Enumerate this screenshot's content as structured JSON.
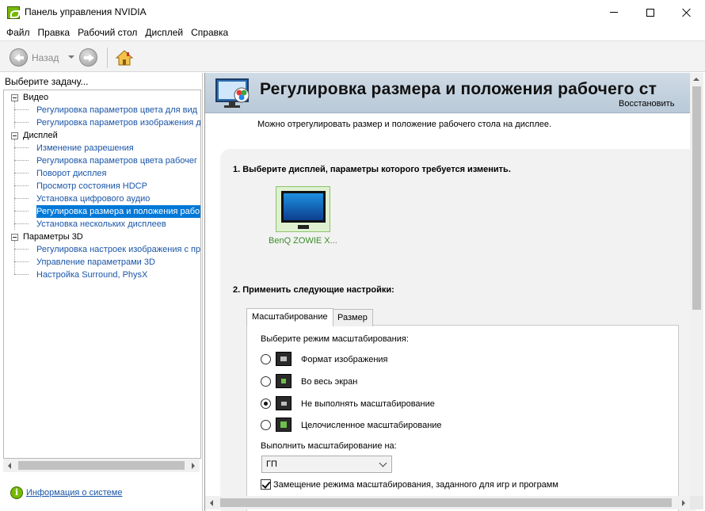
{
  "window": {
    "title": "Панель управления NVIDIA"
  },
  "menu": [
    "Файл",
    "Правка",
    "Рабочий стол",
    "Дисплей",
    "Справка"
  ],
  "toolbar": {
    "back_label": "Назад"
  },
  "left_panel": {
    "header": "Выберите задачу...",
    "tree": [
      {
        "type": "category",
        "label": "Видео"
      },
      {
        "type": "link",
        "label": "Регулировка параметров цвета для вид"
      },
      {
        "type": "link",
        "label": "Регулировка параметров изображения д"
      },
      {
        "type": "category",
        "label": "Дисплей"
      },
      {
        "type": "link",
        "label": "Изменение разрешения"
      },
      {
        "type": "link",
        "label": "Регулировка параметров цвета рабочег"
      },
      {
        "type": "link",
        "label": "Поворот дисплея"
      },
      {
        "type": "link",
        "label": "Просмотр состояния HDCP"
      },
      {
        "type": "link",
        "label": "Установка цифрового аудио"
      },
      {
        "type": "link",
        "label": "Регулировка размера и положения рабо",
        "selected": true
      },
      {
        "type": "link",
        "label": "Установка нескольких дисплеев"
      },
      {
        "type": "category",
        "label": "Параметры 3D"
      },
      {
        "type": "link",
        "label": "Регулировка настроек изображения с пр"
      },
      {
        "type": "link",
        "label": "Управление параметрами 3D"
      },
      {
        "type": "link",
        "label": "Настройка Surround, PhysX"
      }
    ],
    "system_info": "Информация о системе"
  },
  "main": {
    "title": "Регулировка размера и положения рабочего ст",
    "restore": "Восстановить",
    "description": "Можно отрегулировать размер и положение рабочего стола на дисплее.",
    "step1": "1. Выберите дисплей, параметры которого требуется изменить.",
    "display_name": "BenQ ZOWIE X...",
    "step2": "2. Применить следующие настройки:",
    "tabs": [
      "Масштабирование",
      "Размер"
    ],
    "scaling_mode_label": "Выберите режим масштабирования:",
    "scaling_options": [
      {
        "label": "Формат изображения",
        "selected": false
      },
      {
        "label": "Во весь экран",
        "selected": false
      },
      {
        "label": "Не выполнять масштабирование",
        "selected": true
      },
      {
        "label": "Целочисленное масштабирование",
        "selected": false
      }
    ],
    "perform_on_label": "Выполнить масштабирование на:",
    "perform_on_value": "ГП",
    "override_label": "Замещение режима масштабирования, заданного для игр и программ",
    "override_checked": true
  },
  "colors": {
    "accent": "#76b900",
    "link": "#1a55a8",
    "selection": "#0078d7"
  }
}
